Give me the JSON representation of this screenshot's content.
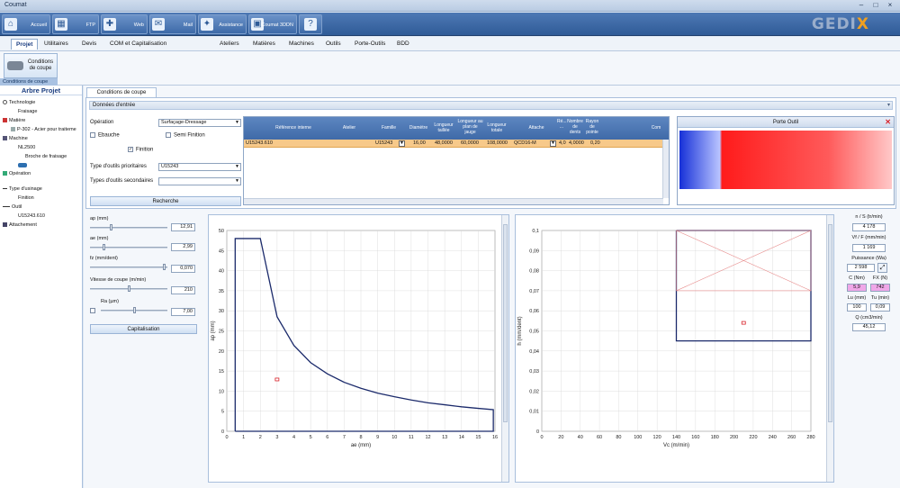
{
  "window": {
    "title": "Coumat"
  },
  "toolbar": [
    {
      "label": "Accueil",
      "icon": "home-icon"
    },
    {
      "label": "FTP",
      "icon": "ftp-icon"
    },
    {
      "label": "Web",
      "icon": "web-icon"
    },
    {
      "label": "Mail",
      "icon": "mail-icon"
    },
    {
      "label": "Assistance",
      "icon": "assistance-icon"
    },
    {
      "label": "Coumat 3DDN",
      "icon": "coumat-icon"
    },
    {
      "label": "",
      "icon": "help-icon"
    }
  ],
  "logo": {
    "text_main": "GEDI",
    "text_accent": "X"
  },
  "menu": [
    "Projet",
    "Utilitaires",
    "Devis",
    "COM et Capitalisation",
    "Ateliers",
    "Matières",
    "Machines",
    "Outils",
    "Porte-Outils",
    "BDD"
  ],
  "ribbon": {
    "button": "Conditions de coupe",
    "group": "Conditions de coupe"
  },
  "sidebar": {
    "title": "Arbre Projet",
    "items": [
      "Technologie",
      "Fraisage",
      "Matière",
      "P-302 - Acier pour traiteme",
      "Machine",
      "NL2500",
      "Broche de fraisage",
      "Opération",
      "Type d'usinage",
      "Finition",
      "Outil",
      "U15243.610",
      "Attachement"
    ]
  },
  "tab": "Conditions de coupe",
  "section": "Données d'entrée",
  "form": {
    "operation_label": "Opération",
    "operation_value": "Surfaçage-Dressage",
    "ebauche": "Ebauche",
    "semi_finition": "Semi Finition",
    "finition": "Finition",
    "finition_check": "✓",
    "prio_label": "Type d'outils prioritaires",
    "prio_value": "U15243",
    "sec_label": "Types d'outils secondaires",
    "sec_value": "",
    "search": "Recherche"
  },
  "grid": {
    "headers": [
      "Référence interne",
      "Atelier",
      "Famille",
      "Diamètre",
      "Longueur taillée",
      "Longueur au plan de jauge",
      "Longueur totale",
      "Attache",
      "Ré... ...",
      "Nombre de dents",
      "Rayon de pointe",
      "Com"
    ],
    "row": [
      "U15243.610",
      "",
      "U15243",
      "16,00",
      "48,0000",
      "60,0000",
      "108,0000",
      "QCD16-M",
      "4,0",
      "4,0000",
      "0,20",
      ""
    ]
  },
  "porte_outil": {
    "title": "Porte Outil"
  },
  "controls": {
    "ap_label": "ap (mm)",
    "ap": "12,91",
    "ae_label": "ae (mm)",
    "ae": "2,99",
    "fz_label": "fz (mm/dent)",
    "fz": "0,070",
    "vc_label": "Vitesse de coupe (m/min)",
    "vc": "210",
    "ra_label": "Ra (µm)",
    "ra": "7,00",
    "cap": "Capitalisation"
  },
  "chart_data": [
    {
      "type": "line",
      "xlabel": "ae (mm)",
      "ylabel": "ap (mm)",
      "xlim": [
        0,
        16
      ],
      "ylim": [
        0,
        50
      ],
      "xticks": [
        0,
        1,
        2,
        3,
        4,
        5,
        6,
        7,
        8,
        9,
        10,
        11,
        12,
        13,
        14,
        15,
        16
      ],
      "yticks": [
        0,
        5,
        10,
        15,
        20,
        25,
        30,
        35,
        40,
        45,
        50
      ],
      "series": [
        {
          "x": [
            0.5,
            0.5,
            2,
            3,
            4,
            5,
            6,
            7,
            8,
            9,
            10,
            11,
            12,
            13,
            14,
            15,
            15.9,
            15.9,
            0.5
          ],
          "y": [
            0,
            48,
            48,
            28.5,
            21.4,
            17.1,
            14.3,
            12.2,
            10.7,
            9.5,
            8.6,
            7.8,
            7.1,
            6.6,
            6.1,
            5.7,
            5.4,
            0,
            0
          ]
        }
      ],
      "point": {
        "x": 3,
        "y": 12.9
      }
    },
    {
      "type": "line",
      "xlabel": "Vc (m/min)",
      "ylabel": "h (mm/dent)",
      "xlim": [
        0,
        280
      ],
      "ylim": [
        0,
        0.1
      ],
      "xticks": [
        0,
        20,
        40,
        60,
        80,
        100,
        120,
        140,
        160,
        180,
        200,
        220,
        240,
        260,
        280
      ],
      "yticks": [
        "0",
        "0,01",
        "0,02",
        "0,03",
        "0,04",
        "0,05",
        "0,06",
        "0,07",
        "0,08",
        "0,09",
        "0,1"
      ],
      "series": [
        {
          "x": [
            140,
            140,
            280,
            280,
            140
          ],
          "y": [
            0.1,
            0.045,
            0.045,
            0.1,
            0.1
          ]
        }
      ],
      "point": {
        "x": 210,
        "y": 0.054
      }
    }
  ],
  "results": {
    "n_label": "n / S (tr/min)",
    "n": "4 178",
    "vf_label": "Vf / F (mm/min)",
    "vf": "1 169",
    "p_label": "Puissance (Wa)",
    "p": "2 598",
    "c_label": "C (Nm)",
    "c": "5,9",
    "fx_label": "FX (N)",
    "fx": "742",
    "lu_label": "Lu (mm)",
    "lu": "100",
    "tu_label": "Tu (min)",
    "tu": "0,09",
    "q_label": "Q (cm3/min)",
    "q": "45,12"
  },
  "colors": {
    "pink": "#f0a7e8",
    "row": "#f7c98a",
    "curve": "#1b2a6b"
  }
}
